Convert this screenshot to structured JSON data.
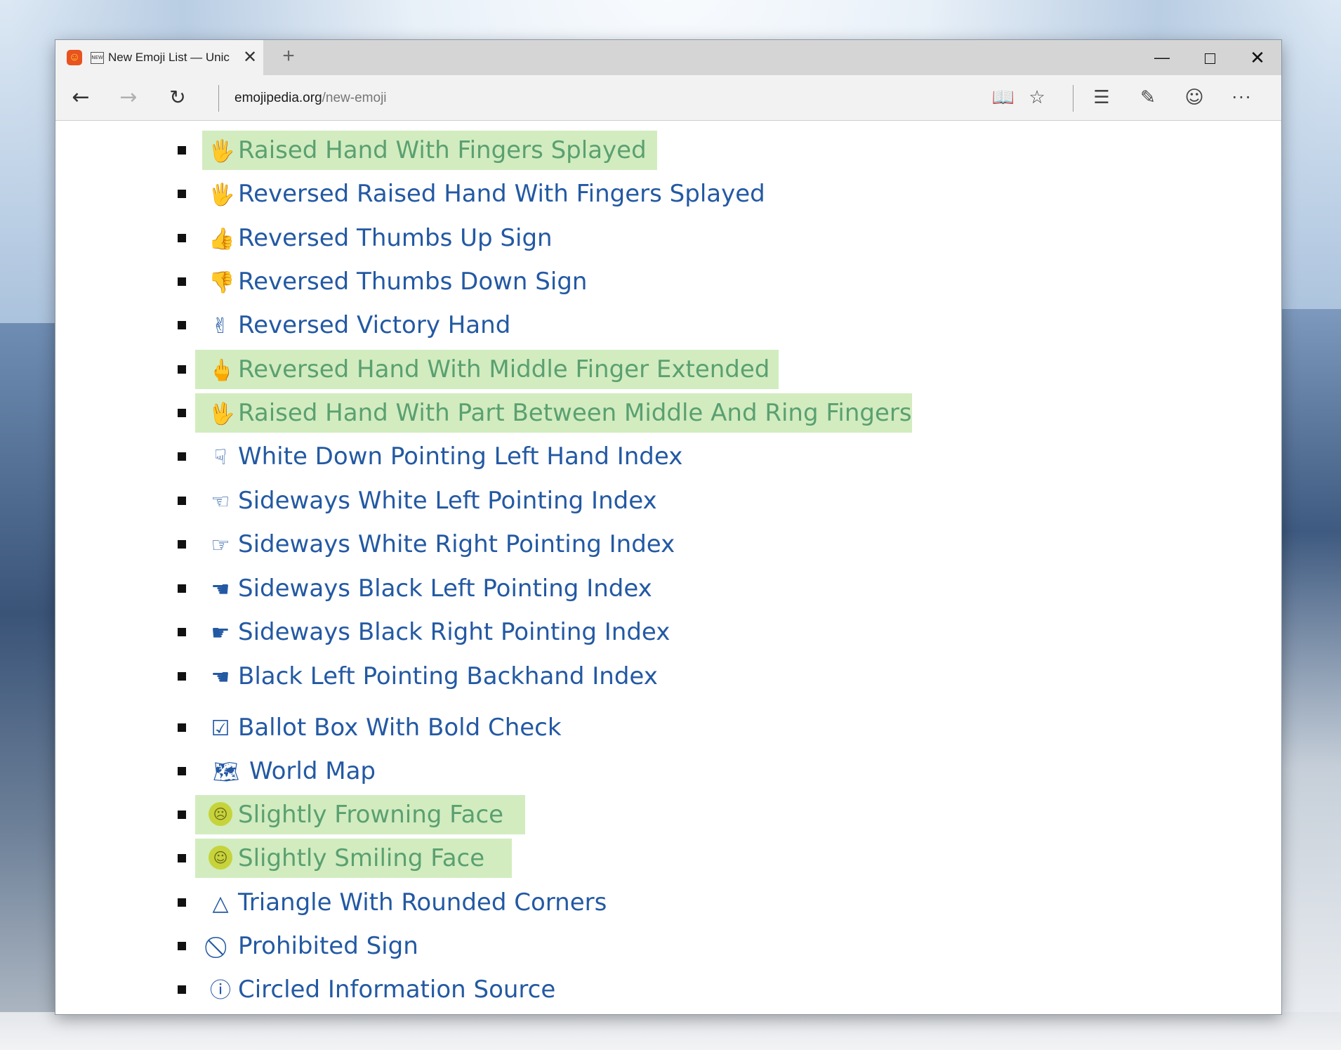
{
  "browser": {
    "tab": {
      "badge": "NEW",
      "title": "New Emoji List — Unic",
      "close_glyph": "✕"
    },
    "new_tab_glyph": "+",
    "window_controls": {
      "minimize_glyph": "—",
      "close_glyph": "✕"
    },
    "nav": {
      "back_glyph": "←",
      "forward_glyph": "→",
      "reload_glyph": "↻"
    },
    "address": {
      "domain": "emojipedia.org",
      "path": "/new-emoji"
    },
    "toolbar": {
      "reading_glyph": "📖",
      "favorite_glyph": "☆",
      "hub_glyph": "☰",
      "note_glyph": "✎",
      "feedback_glyph": "☺",
      "more_glyph": "···"
    }
  },
  "emoji_list": [
    {
      "glyph": "🖐",
      "label": "Raised Hand With Fingers Splayed",
      "highlighted": true,
      "glyph_color": "#7aa15a"
    },
    {
      "glyph": "🖐",
      "label": "Reversed Raised Hand With Fingers Splayed",
      "highlighted": false
    },
    {
      "glyph": "👍",
      "label": "Reversed Thumbs Up Sign",
      "highlighted": false
    },
    {
      "glyph": "👎",
      "label": "Reversed Thumbs Down Sign",
      "highlighted": false
    },
    {
      "glyph": "✌",
      "label": "Reversed Victory Hand",
      "highlighted": false
    },
    {
      "glyph": "🖕",
      "label": "Reversed Hand With Middle Finger Extended",
      "highlighted": true,
      "glyph_color": "#7aa15a"
    },
    {
      "glyph": "🖖",
      "label": "Raised Hand With Part Between Middle And Ring Fingers",
      "highlighted": true,
      "glyph_color": "#7aa15a"
    },
    {
      "glyph": "☟",
      "label": "White Down Pointing Left Hand Index",
      "highlighted": false
    },
    {
      "glyph": "☜",
      "label": "Sideways White Left Pointing Index",
      "highlighted": false
    },
    {
      "glyph": "☞",
      "label": "Sideways White Right Pointing Index",
      "highlighted": false
    },
    {
      "glyph": "☚",
      "label": "Sideways Black Left Pointing Index",
      "highlighted": false
    },
    {
      "glyph": "☛",
      "label": "Sideways Black Right Pointing Index",
      "highlighted": false
    },
    {
      "glyph": "☚",
      "label": "Black Left Pointing Backhand Index",
      "highlighted": false
    },
    {
      "glyph": "☑",
      "label": "Ballot Box With Bold Check",
      "highlighted": false
    },
    {
      "glyph": "🗺",
      "label": "World Map",
      "highlighted": false
    },
    {
      "glyph": "☹",
      "label": "Slightly Frowning Face",
      "highlighted": true,
      "face": true
    },
    {
      "glyph": "☺",
      "label": "Slightly Smiling Face",
      "highlighted": true,
      "face": true
    },
    {
      "glyph": "△",
      "label": "Triangle With Rounded Corners",
      "highlighted": false
    },
    {
      "glyph": "⃠",
      "label": "Prohibited Sign",
      "highlighted": false
    },
    {
      "glyph": "ⓘ",
      "label": "Circled Information Source",
      "highlighted": false
    }
  ],
  "colors": {
    "link": "#2359a3",
    "highlight_bg": "#d2ecbf",
    "highlight_text": "#5aa071",
    "face_fill": "#c6d33a"
  }
}
